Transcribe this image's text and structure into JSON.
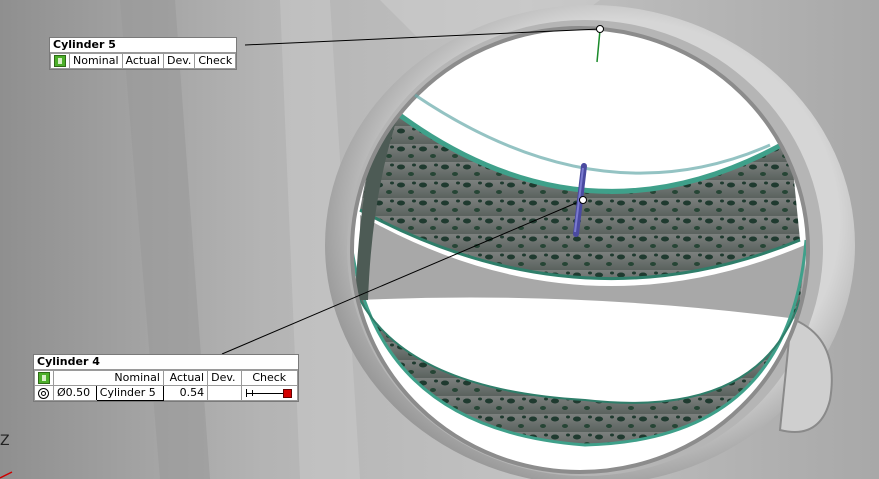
{
  "scene": {
    "axis_label": "Z",
    "colors": {
      "mesh": "#9e9e9e",
      "band": "#5f6b66",
      "band_edge": "#3fa08a",
      "highlight": "#ffffff"
    }
  },
  "cylinder5": {
    "title": "Cylinder 5",
    "status_icon": "green-status-icon",
    "headers": [
      "Nominal",
      "Actual",
      "Dev.",
      "Check"
    ]
  },
  "cylinder4": {
    "title": "Cylinder 4",
    "status_icon": "green-status-icon",
    "headers": [
      "Nominal",
      "Actual",
      "Dev.",
      "Check"
    ],
    "row": {
      "symbol": "concentricity-icon",
      "tolerance": "Ø0.50",
      "reference": "Cylinder 5",
      "actual": "0.54",
      "dev": "",
      "check_fraction": 1.08
    }
  }
}
